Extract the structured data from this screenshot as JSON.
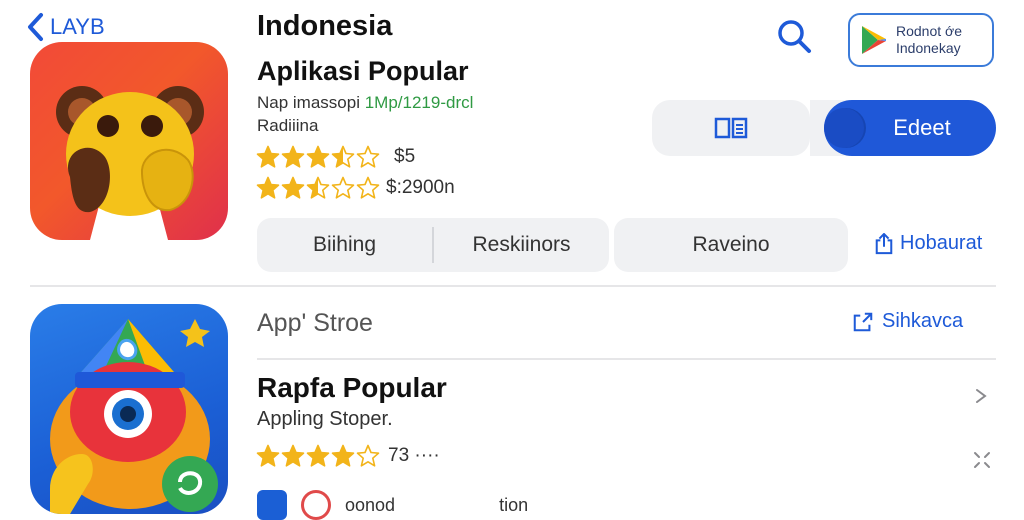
{
  "nav": {
    "back_label": "LAYB"
  },
  "header": {
    "country": "Indonesia",
    "section_title": "Aplikasi Popular"
  },
  "app1": {
    "sub_line_prefix": "Nap imassopi ",
    "sub_line_green": "1Mp/1219-drcl",
    "publisher": "Radiiina",
    "rating1_value": 3.5,
    "rating1_text": "$5",
    "rating2_value": 2.5,
    "rating2_text": "$:2900n"
  },
  "store_badge": {
    "line1": "Rodnot ớe",
    "line2": "Indonekay"
  },
  "actions": {
    "primary_button": "Edeet"
  },
  "tabs": [
    "Biihing",
    "Reskiinors",
    "Raveino"
  ],
  "share": {
    "label1": "Hobaurat",
    "label2": "Sihkavca"
  },
  "section2": {
    "store_label": "App' Stroe",
    "title": "Rapfa Popular",
    "subtitle": "Appling Stoper.",
    "rating_value": 4,
    "rating_text": "73 ····"
  },
  "bottom_row": {
    "text1": "oonod",
    "text2": "tion"
  },
  "colors": {
    "accent": "#1f58d8",
    "link": "#1e5ad8",
    "star": "#f2b41a",
    "green": "#2f9a43"
  },
  "icons": [
    "chevron-left-icon",
    "search-icon",
    "play-store-icon",
    "book-icon",
    "share-icon",
    "chevron-right-icon",
    "expand-icon",
    "star-icon"
  ]
}
